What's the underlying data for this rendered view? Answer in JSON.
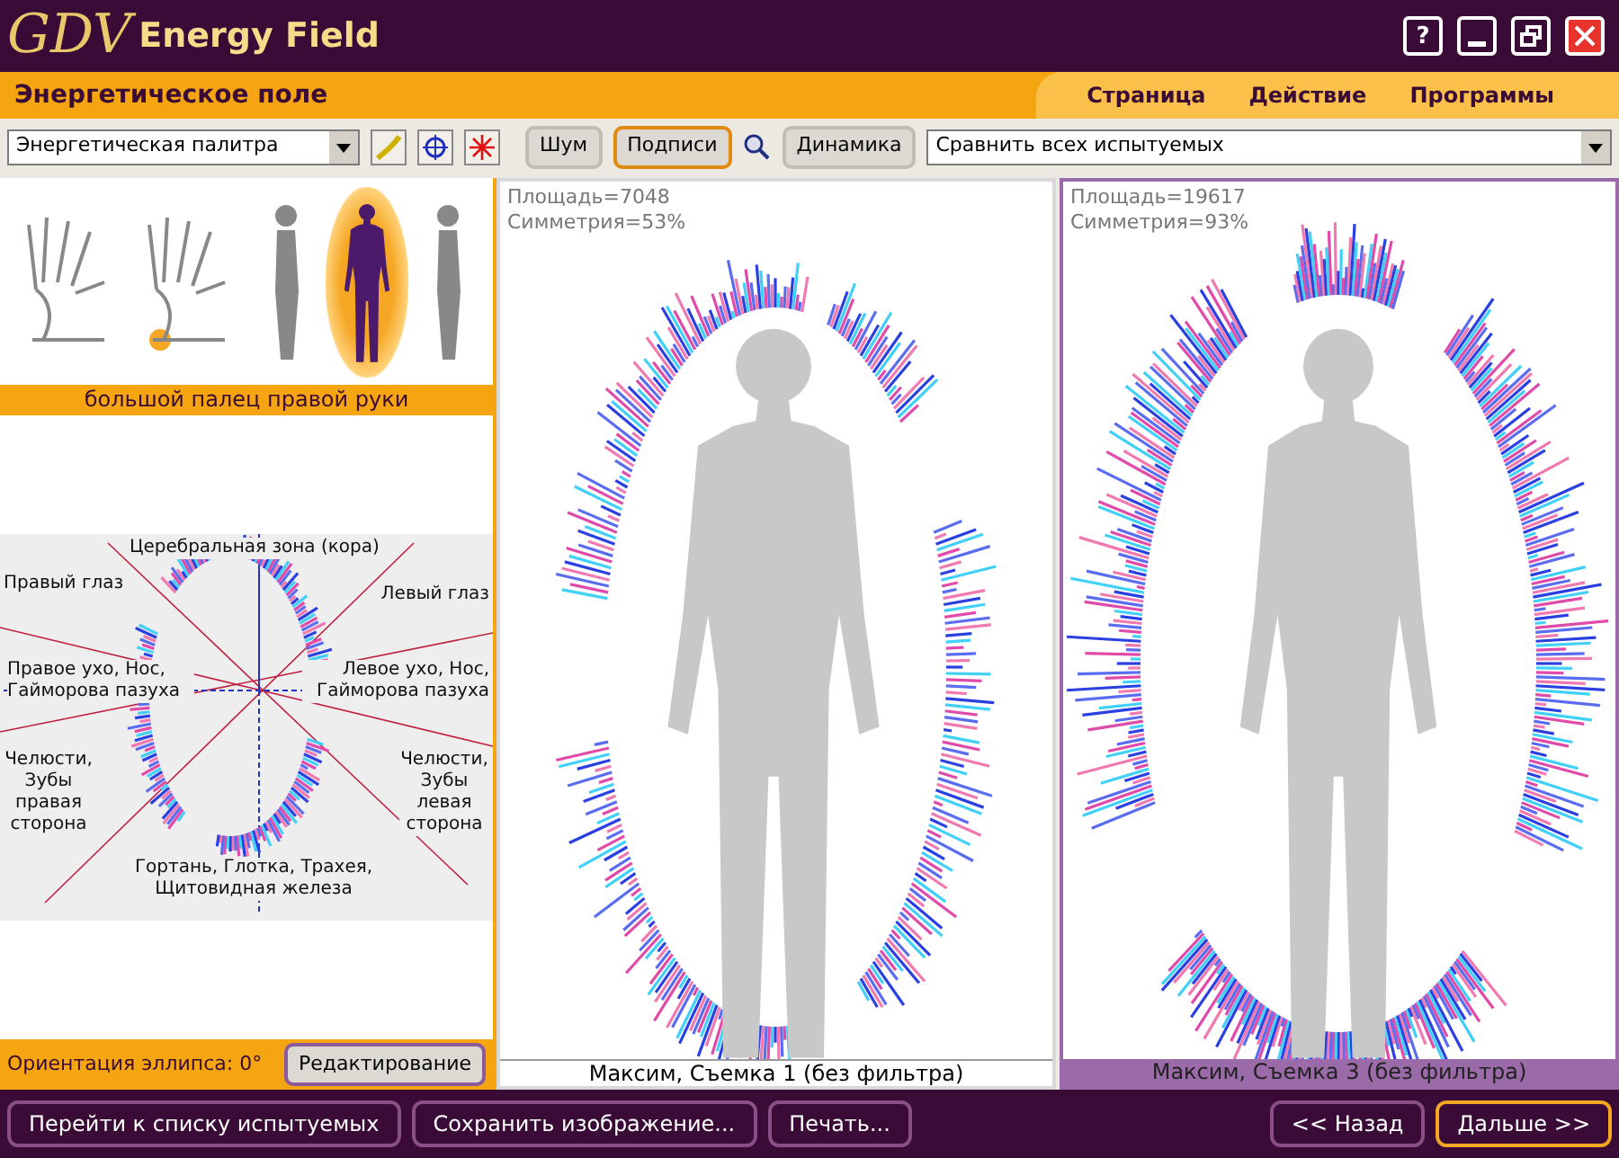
{
  "window": {
    "logo": "GDV",
    "title": "Energy Field",
    "help": "?"
  },
  "header": {
    "title": "Энергетическое поле",
    "menu": [
      "Страница",
      "Действие",
      "Программы"
    ]
  },
  "toolbar": {
    "palette": "Энергетическая палитра",
    "toggles": [
      {
        "label": "Шум",
        "selected": false
      },
      {
        "label": "Подписи",
        "selected": true
      }
    ],
    "dynamics": "Динамика",
    "compare": "Сравнить всех испытуемых"
  },
  "figures": [
    {
      "kind": "hand-left",
      "selected": false
    },
    {
      "kind": "hand-right",
      "selected": false
    },
    {
      "kind": "body-side",
      "selected": false
    },
    {
      "kind": "body-front",
      "selected": true
    },
    {
      "kind": "body-side",
      "selected": false
    }
  ],
  "finger_label": "большой палец правой руки",
  "diagram": {
    "zones": [
      {
        "kind": "top",
        "text": "Церебральная зона (кора)"
      },
      {
        "kind": "upper-left",
        "text": "Правый глаз"
      },
      {
        "kind": "upper-right",
        "text": "Левый глаз"
      },
      {
        "kind": "mid-left",
        "text": "Правое ухо, Нос, Гайморова пазуха"
      },
      {
        "kind": "mid-right",
        "text": "Левое ухо, Нос, Гайморова пазуха"
      },
      {
        "kind": "lower-left",
        "text": "Челюсти, Зубы правая сторона"
      },
      {
        "kind": "lower-right",
        "text": "Челюсти, Зубы левая сторона"
      },
      {
        "kind": "bottom",
        "text": "Гортань, Глотка, Трахея, Щитовидная железа"
      }
    ],
    "orientation": "Ориентация эллипса: 0°",
    "edit_button": "Редактирование"
  },
  "panels": [
    {
      "area": "Площадь=7048",
      "symmetry": "Симметрия=53%",
      "caption": "Максим, Съемка 1 (без фильтра)",
      "selected": false
    },
    {
      "area": "Площадь=19617",
      "symmetry": "Симметрия=93%",
      "caption": "Максим, Съемка 3 (без фильтра)",
      "selected": true
    }
  ],
  "bottom_buttons": [
    {
      "label": "Перейти к списку испытуемых",
      "selected": false
    },
    {
      "label": "Сохранить изображение...",
      "selected": false
    },
    {
      "label": "Печать...",
      "selected": false
    }
  ],
  "nav_buttons": [
    {
      "label": "<< Назад",
      "selected": false
    },
    {
      "label": "Дальше >>",
      "selected": true
    }
  ]
}
